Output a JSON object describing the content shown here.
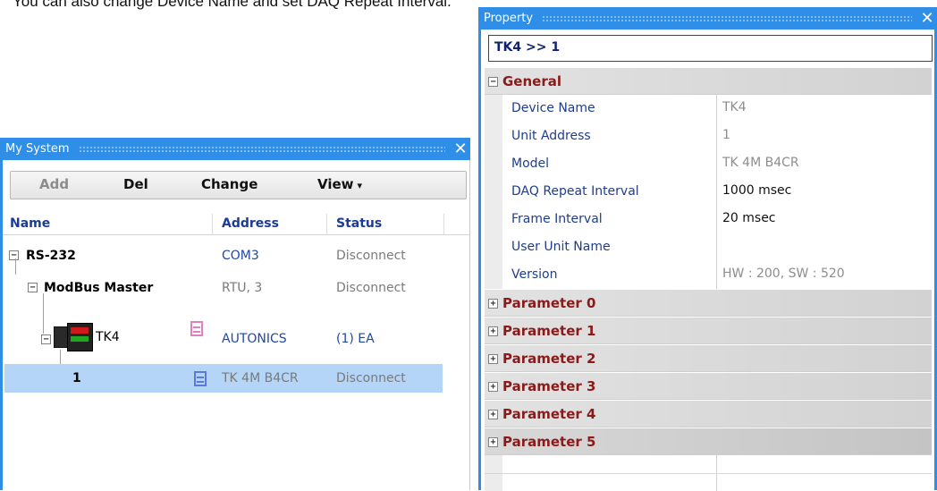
{
  "caption": "You can also change Device Name and set DAQ Repeat Interval.",
  "my_system": {
    "title": "My System",
    "close": "✕",
    "toolbar": {
      "add": "Add",
      "del": "Del",
      "change": "Change",
      "view": "View",
      "view_caret": "▾"
    },
    "columns": {
      "name": "Name",
      "address": "Address",
      "status": "Status"
    },
    "rows": [
      {
        "name": "RS-232",
        "address": "COM3",
        "status": "Disconnect"
      },
      {
        "name": "ModBus Master",
        "address": "RTU, 3",
        "status": "Disconnect"
      },
      {
        "name": "TK4",
        "address": "AUTONICS",
        "status": "(1) EA"
      },
      {
        "name": "1",
        "address": "TK 4M B4CR",
        "status": "Disconnect"
      }
    ],
    "expand_symbol": "⊟"
  },
  "property": {
    "title": "Property",
    "close": "✕",
    "breadcrumb": "TK4 >> 1",
    "general": {
      "label": "General",
      "rows": [
        {
          "key": "Device Name",
          "value": "TK4"
        },
        {
          "key": "Unit Address",
          "value": "1"
        },
        {
          "key": "Model",
          "value": "TK 4M B4CR"
        },
        {
          "key": "DAQ Repeat Interval",
          "value": "1000 msec"
        },
        {
          "key": "Frame Interval",
          "value": "20 msec"
        },
        {
          "key": "User Unit Name",
          "value": ""
        },
        {
          "key": "Version",
          "value": "HW : 200, SW : 520"
        }
      ]
    },
    "groups": [
      "Parameter 0",
      "Parameter 1",
      "Parameter 2",
      "Parameter 3",
      "Parameter 4",
      "Parameter 5"
    ],
    "collapsed_symbol": "+",
    "expanded_symbol": "−"
  },
  "colors": {
    "title_bar": "#2e8ee8",
    "selection": "#b4d5f7",
    "group_label": "#8b1a1a"
  }
}
